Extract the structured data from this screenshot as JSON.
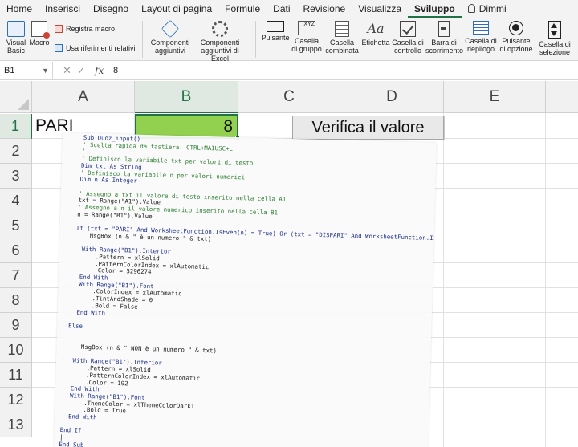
{
  "ribbon_tabs": [
    "Home",
    "Inserisci",
    "Disegno",
    "Layout di pagina",
    "Formule",
    "Dati",
    "Revisione",
    "Visualizza",
    "Sviluppo",
    "Dimmi"
  ],
  "active_tab": "Sviluppo",
  "ribbon": {
    "visual_basic": [
      "Visual",
      "Basic"
    ],
    "macro": "Macro",
    "registra_macro": "Registra macro",
    "usa_riferimenti": "Usa riferimenti relativi",
    "componenti_aggiuntivi": [
      "Componenti",
      "aggiuntivi"
    ],
    "componenti_excel": [
      "Componenti",
      "aggiuntivi di Excel"
    ],
    "pulsante": "Pulsante",
    "casella_gruppo": [
      "Casella",
      "di gruppo"
    ],
    "casella_combinata": [
      "Casella",
      "combinata"
    ],
    "etichetta": "Etichetta",
    "casella_controllo": [
      "Casella di",
      "controllo"
    ],
    "barra_scorrimento": [
      "Barra di",
      "scorrimento"
    ],
    "casella_riepilogo": [
      "Casella di",
      "riepilogo"
    ],
    "pulsante_opzione": [
      "Pulsante",
      "di opzione"
    ],
    "casella_selezione": [
      "Casella di",
      "selezione"
    ],
    "group_icon_text": "XYZ",
    "label_icon_text": "Aa"
  },
  "formula_bar": {
    "cell_ref": "B1",
    "cancel": "✕",
    "enter": "✓",
    "fx": "fx",
    "value": "8"
  },
  "columns": [
    "A",
    "B",
    "C",
    "D",
    "E"
  ],
  "selected_column": "B",
  "rows": [
    "1",
    "2",
    "3",
    "4",
    "5",
    "6",
    "7",
    "8",
    "9",
    "10",
    "11",
    "12",
    "13"
  ],
  "selected_row": "1",
  "cells": {
    "A1": "PARI",
    "B1": "8"
  },
  "cell_fill": "#92d050",
  "selection_color": "#217346",
  "button_label": "Verifica il valore",
  "vba_code": [
    {
      "t": "Sub Quoz_input()",
      "k": "kw"
    },
    {
      "t": "' Scelta rapida da tastiera: CTRL+MAIUSC+L",
      "k": "cm"
    },
    {
      "t": "'",
      "k": "cm"
    },
    {
      "t": "' Definisco la variabile txt per valori di testo",
      "k": "cm"
    },
    {
      "t": "Dim txt As String",
      "k": "kw"
    },
    {
      "t": "' Definisco la variabile n per valori numerici",
      "k": "cm"
    },
    {
      "t": "Dim n As Integer",
      "k": "kw"
    },
    {
      "t": "",
      "k": ""
    },
    {
      "t": "' Assegno a txt il valore di testo inserito nella cella A1",
      "k": "cm"
    },
    {
      "t": "txt = Range(\"A1\").Value",
      "k": ""
    },
    {
      "t": "' Assegno a n il valore numerico inserito nella cella B1",
      "k": "cm"
    },
    {
      "t": "n = Range(\"B1\").Value",
      "k": ""
    },
    {
      "t": "",
      "k": ""
    },
    {
      "t": "If (txt = \"PARI\" And WorksheetFunction.IsEven(n) = True) Or (txt = \"DISPARI\" And WorksheetFunction.IsOdd(n) = True) Then",
      "k": "kw"
    },
    {
      "t": "    MsgBox (n & \" è un numero \" & txt)",
      "k": ""
    },
    {
      "t": "",
      "k": ""
    },
    {
      "t": "  With Range(\"B1\").Interior",
      "k": "kw"
    },
    {
      "t": "      .Pattern = xlSolid",
      "k": ""
    },
    {
      "t": "      .PatternColorIndex = xlAutomatic",
      "k": ""
    },
    {
      "t": "      .Color = 5296274",
      "k": ""
    },
    {
      "t": "  End With",
      "k": "kw"
    },
    {
      "t": "  With Range(\"B1\").Font",
      "k": "kw"
    },
    {
      "t": "      .ColorIndex = xlAutomatic",
      "k": ""
    },
    {
      "t": "      .TintAndShade = 0",
      "k": ""
    },
    {
      "t": "      .Bold = False",
      "k": ""
    },
    {
      "t": "  End With",
      "k": "kw"
    },
    {
      "t": "",
      "k": ""
    },
    {
      "t": "Else",
      "k": "kw"
    },
    {
      "t": "",
      "k": ""
    },
    {
      "t": "",
      "k": ""
    },
    {
      "t": "    MsgBox (n & \" NON è un numero \" & txt)",
      "k": ""
    },
    {
      "t": "",
      "k": ""
    },
    {
      "t": "  With Range(\"B1\").Interior",
      "k": "kw"
    },
    {
      "t": "      .Pattern = xlSolid",
      "k": ""
    },
    {
      "t": "      .PatternColorIndex = xlAutomatic",
      "k": ""
    },
    {
      "t": "      .Color = 192",
      "k": ""
    },
    {
      "t": "  End With",
      "k": "kw"
    },
    {
      "t": "  With Range(\"B1\").Font",
      "k": "kw"
    },
    {
      "t": "      .ThemeColor = xlThemeColorDark1",
      "k": ""
    },
    {
      "t": "      .Bold = True",
      "k": ""
    },
    {
      "t": "  End With",
      "k": "kw"
    },
    {
      "t": "",
      "k": ""
    },
    {
      "t": "End If",
      "k": "kw"
    },
    {
      "t": "|",
      "k": ""
    },
    {
      "t": "End Sub",
      "k": "kw"
    }
  ]
}
